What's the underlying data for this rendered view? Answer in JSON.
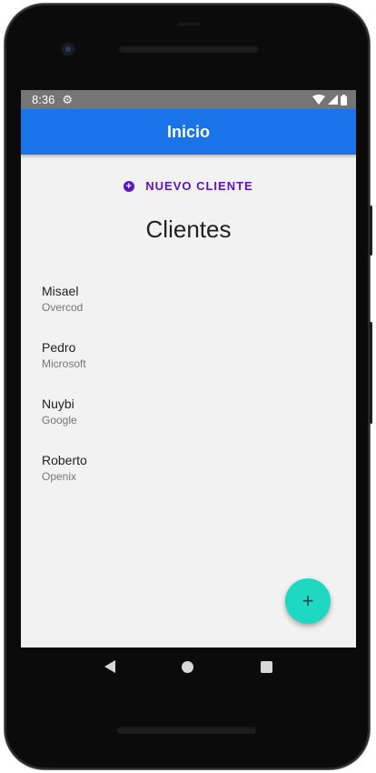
{
  "status_bar": {
    "time": "8:36",
    "gear_icon": "gear-icon",
    "wifi_icon": "wifi-icon",
    "signal_icon": "signal-icon",
    "battery_icon": "battery-icon"
  },
  "app_bar": {
    "title": "Inicio",
    "color": "#1a73e8"
  },
  "new_client_button": {
    "label": "NUEVO CLIENTE",
    "icon": "add-circle-icon",
    "color": "#5b12c9"
  },
  "heading": "Clientes",
  "clients": [
    {
      "name": "Misael",
      "company": "Overcod"
    },
    {
      "name": "Pedro",
      "company": "Microsoft"
    },
    {
      "name": "Nuybi",
      "company": "Google"
    },
    {
      "name": "Roberto",
      "company": "Openix"
    }
  ],
  "fab": {
    "icon": "plus-icon",
    "glyph": "+",
    "color": "#1ed8c2"
  },
  "nav_bar": {
    "back_icon": "back-icon",
    "home_icon": "home-icon",
    "recents_icon": "recents-icon"
  }
}
